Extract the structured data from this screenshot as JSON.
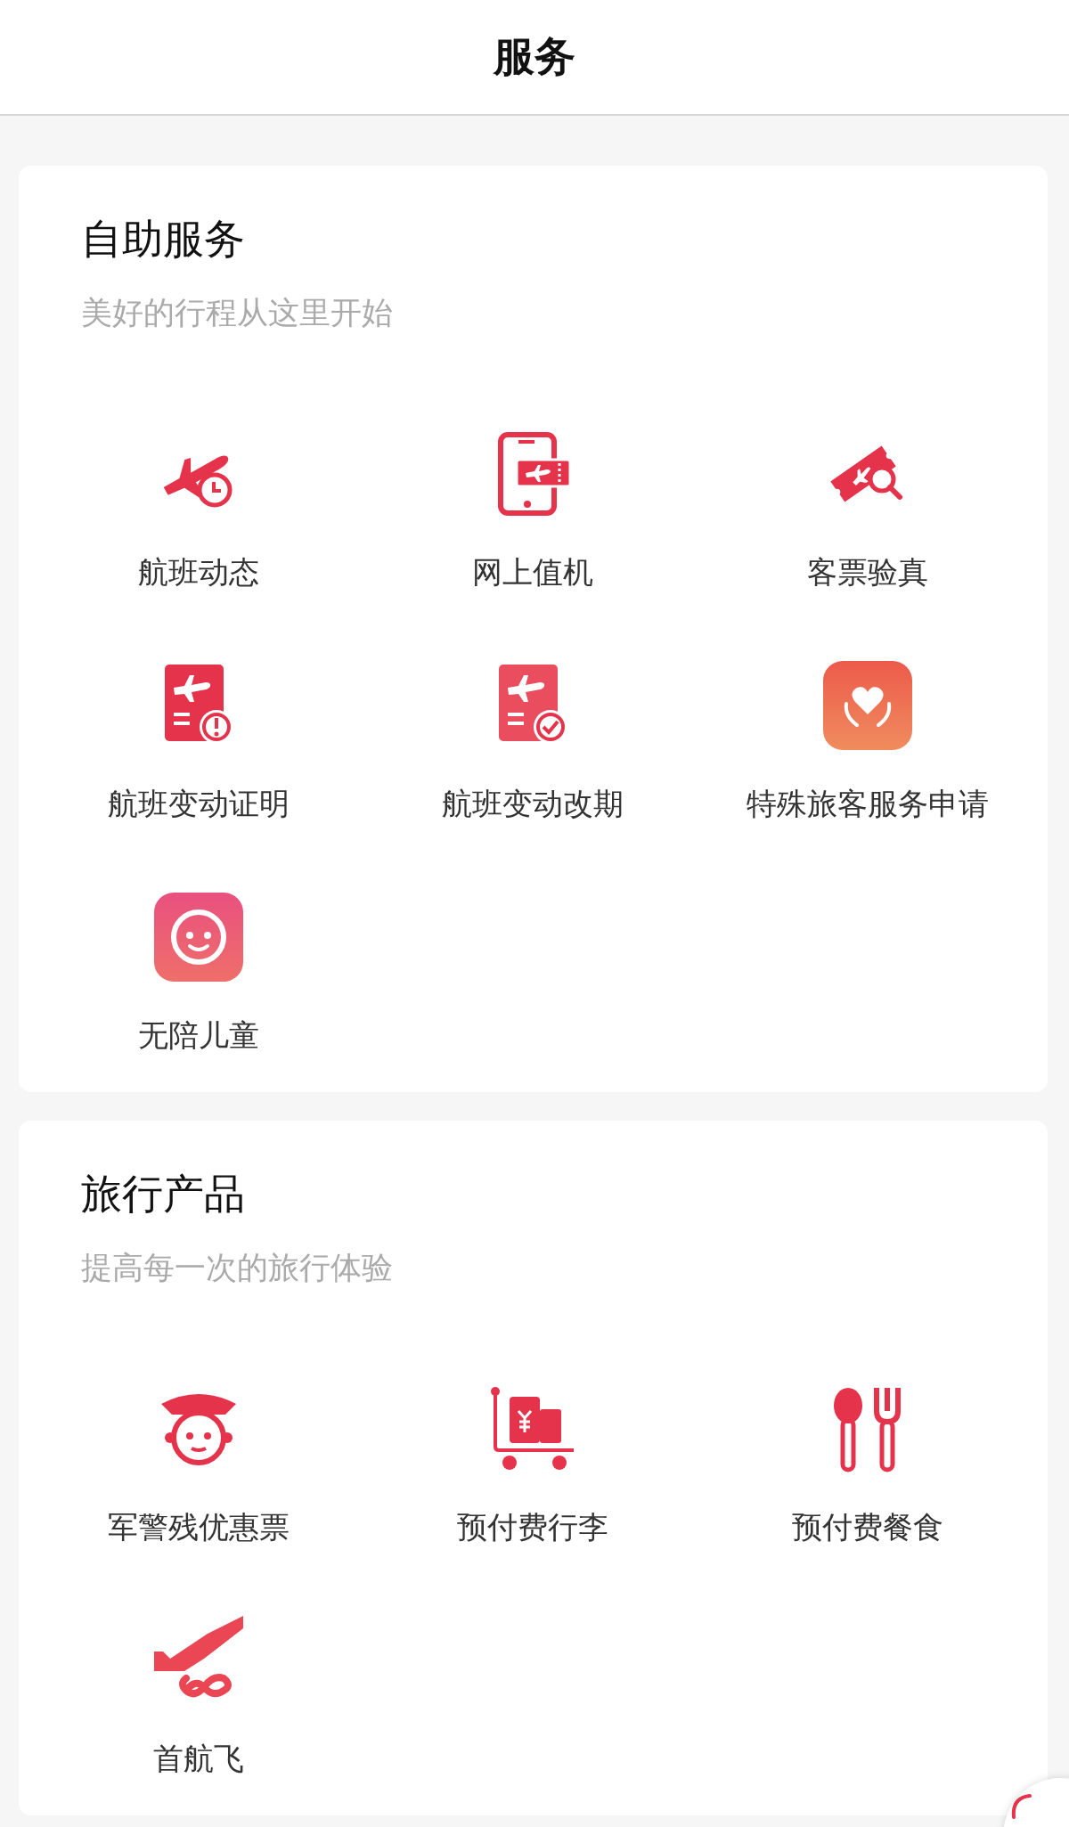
{
  "header": {
    "title": "服务"
  },
  "sections": [
    {
      "title": "自助服务",
      "subtitle": "美好的行程从这里开始",
      "items": [
        {
          "label": "航班动态"
        },
        {
          "label": "网上值机"
        },
        {
          "label": "客票验真"
        },
        {
          "label": "航班变动证明"
        },
        {
          "label": "航班变动改期"
        },
        {
          "label": "特殊旅客服务申请"
        },
        {
          "label": "无陪儿童"
        }
      ]
    },
    {
      "title": "旅行产品",
      "subtitle": "提高每一次的旅行体验",
      "items": [
        {
          "label": "军警残优惠票"
        },
        {
          "label": "预付费行李"
        },
        {
          "label": "预付费餐食"
        },
        {
          "label": "首航飞"
        }
      ]
    }
  ]
}
